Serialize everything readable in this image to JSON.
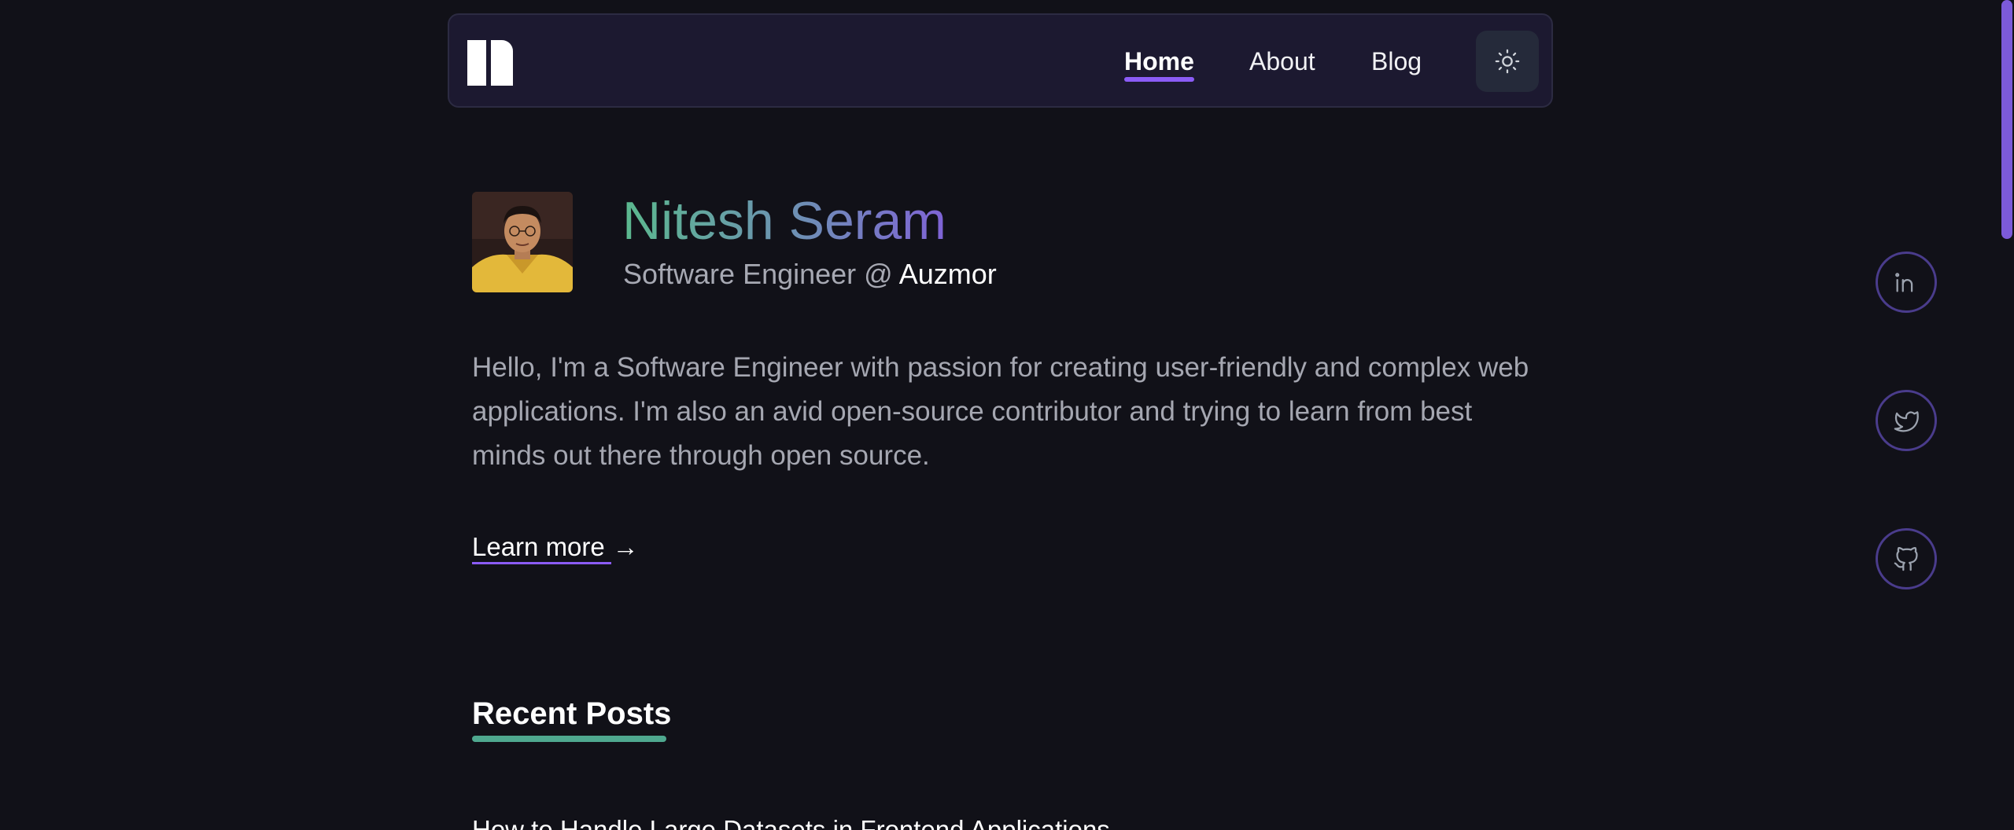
{
  "nav": {
    "logo": "site-logo",
    "links": [
      {
        "label": "Home",
        "active": true
      },
      {
        "label": "About",
        "active": false
      },
      {
        "label": "Blog",
        "active": false
      }
    ],
    "theme_toggle_icon": "sun-icon"
  },
  "hero": {
    "name": "Nitesh Seram",
    "role_prefix": "Software Engineer @ ",
    "company": "Auzmor",
    "intro": "Hello, I'm a Software Engineer with passion for creating user-friendly and complex web applications. I'm also an avid open-source contributor and trying to learn from best minds out there through open source.",
    "learn_more": "Learn more",
    "learn_more_arrow": "→"
  },
  "recent_posts": {
    "heading": "Recent Posts",
    "posts": [
      {
        "title": "How to Handle Large Datasets in Frontend Applications"
      }
    ]
  },
  "social": [
    {
      "icon": "linkedin-icon"
    },
    {
      "icon": "twitter-icon"
    },
    {
      "icon": "github-icon"
    }
  ],
  "colors": {
    "background": "#111118",
    "navbar": "#1c1930",
    "accent_purple": "#8b5cf6",
    "accent_green": "#4fa88f",
    "name_gradient_start": "#5bb98e",
    "name_gradient_end": "#7f63d6"
  }
}
